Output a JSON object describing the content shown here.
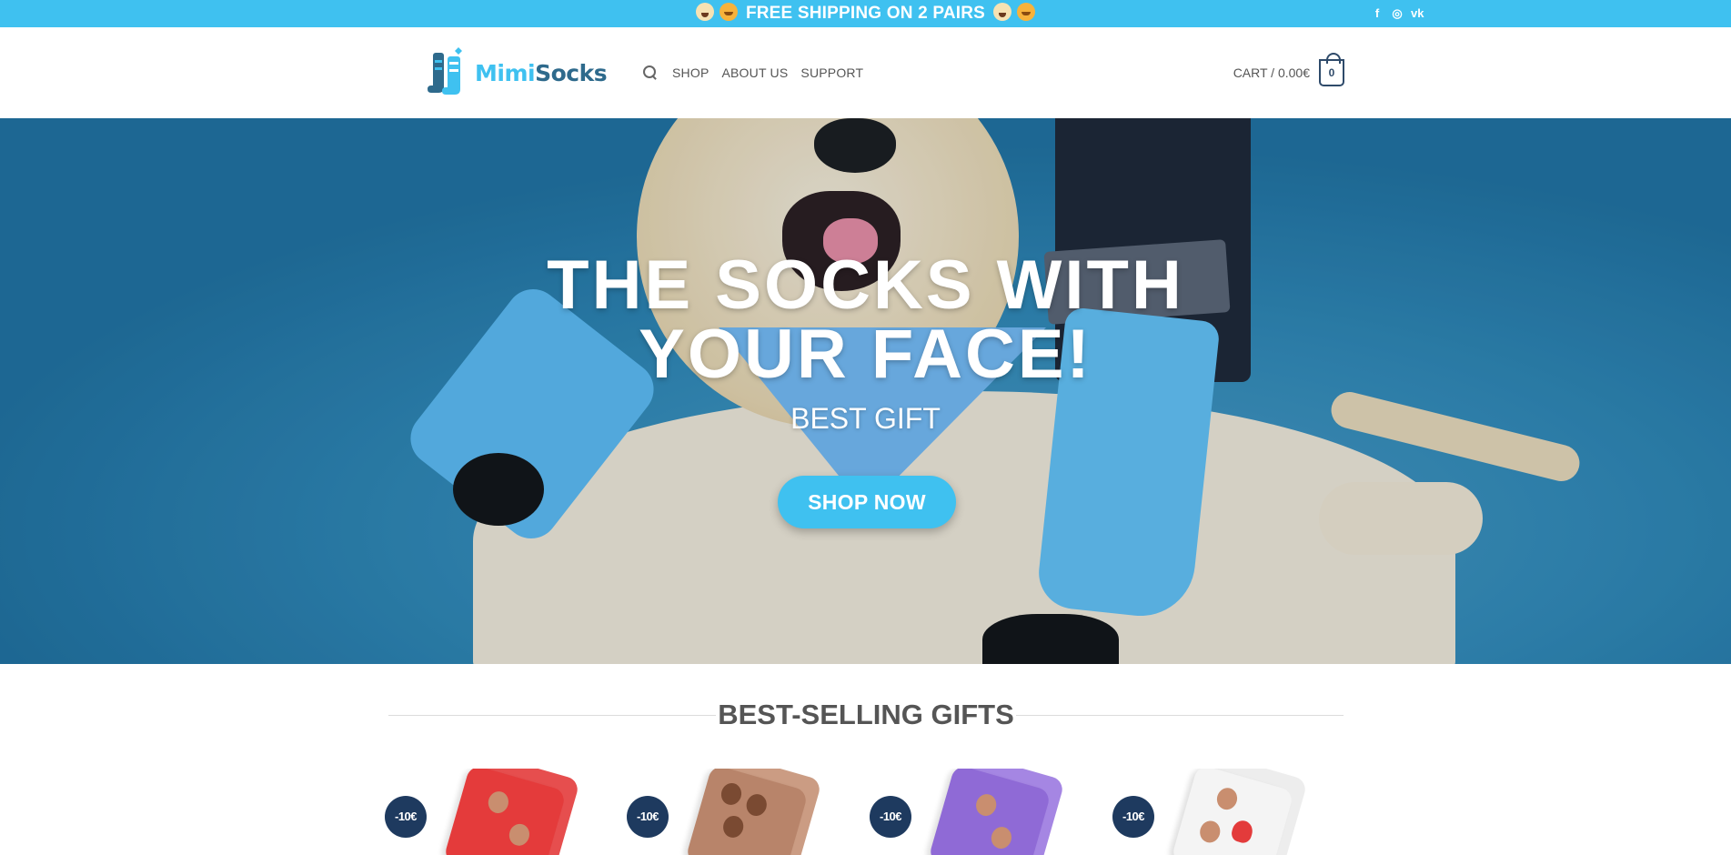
{
  "topbar": {
    "message": "FREE SHIPPING ON 2 PAIRS",
    "emojis": [
      "dog-face-emoji",
      "cat-face-emoji",
      "dog-face-emoji",
      "cat-face-emoji"
    ],
    "social": [
      {
        "name": "facebook-icon",
        "glyph": "f"
      },
      {
        "name": "instagram-icon",
        "glyph": "◎"
      },
      {
        "name": "vk-icon",
        "glyph": "vk"
      }
    ],
    "bg_color": "#3fc1f0"
  },
  "header": {
    "logo": {
      "part1": "Mimi",
      "part2": "Socks"
    },
    "nav": [
      {
        "label": "SHOP"
      },
      {
        "label": "ABOUT US"
      },
      {
        "label": "SUPPORT"
      }
    ],
    "cart_label": "CART / 0.00€",
    "cart_count": "0"
  },
  "hero": {
    "title_line1": "THE SOCKS WITH",
    "title_line2": "YOUR FACE!",
    "subtitle": "BEST GIFT",
    "cta": "SHOP NOW",
    "cta_color": "#3fc1f0"
  },
  "bestsellers": {
    "title": "BEST-SELLING GIFTS",
    "products": [
      {
        "badge": "-10€",
        "color": "#e43b3b"
      },
      {
        "badge": "-10€",
        "color": "#b8846a"
      },
      {
        "badge": "-10€",
        "color": "#8f6ad6"
      },
      {
        "badge": "-10€",
        "color": "#f2f2f2"
      }
    ]
  }
}
